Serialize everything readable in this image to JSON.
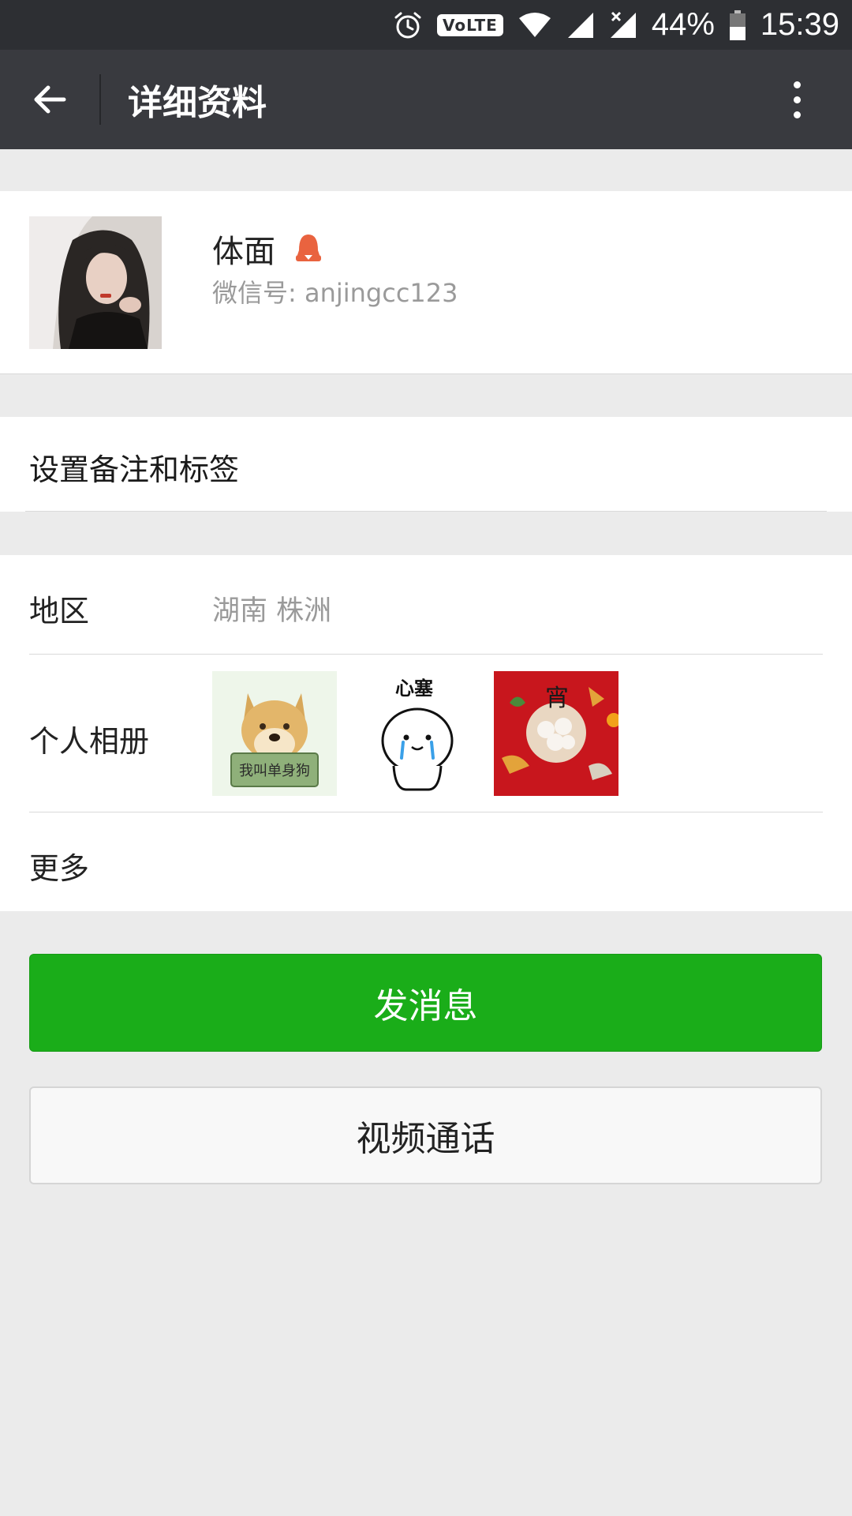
{
  "status_bar": {
    "volte": "VoLTE",
    "battery": "44%",
    "time": "15:39"
  },
  "app_bar": {
    "title": "详细资料"
  },
  "profile": {
    "name": "体面",
    "wechat_id": "微信号: anjingcc123",
    "gender_icon": "female-icon",
    "gender_color": "#e9633f"
  },
  "remark": {
    "label": "设置备注和标签"
  },
  "info": {
    "region_label": "地区",
    "region_value": "湖南  株洲",
    "album_label": "个人相册",
    "album_photos": [
      {
        "caption": "我叫单身狗"
      },
      {
        "caption": "心塞"
      },
      {
        "caption": "宵"
      }
    ],
    "more_label": "更多"
  },
  "actions": {
    "send_message": "发消息",
    "video_call": "视频通话"
  },
  "colors": {
    "primary_green": "#1aad19",
    "app_bar": "#393a3f",
    "status_bar": "#2d2f33",
    "background": "#ebebeb"
  }
}
